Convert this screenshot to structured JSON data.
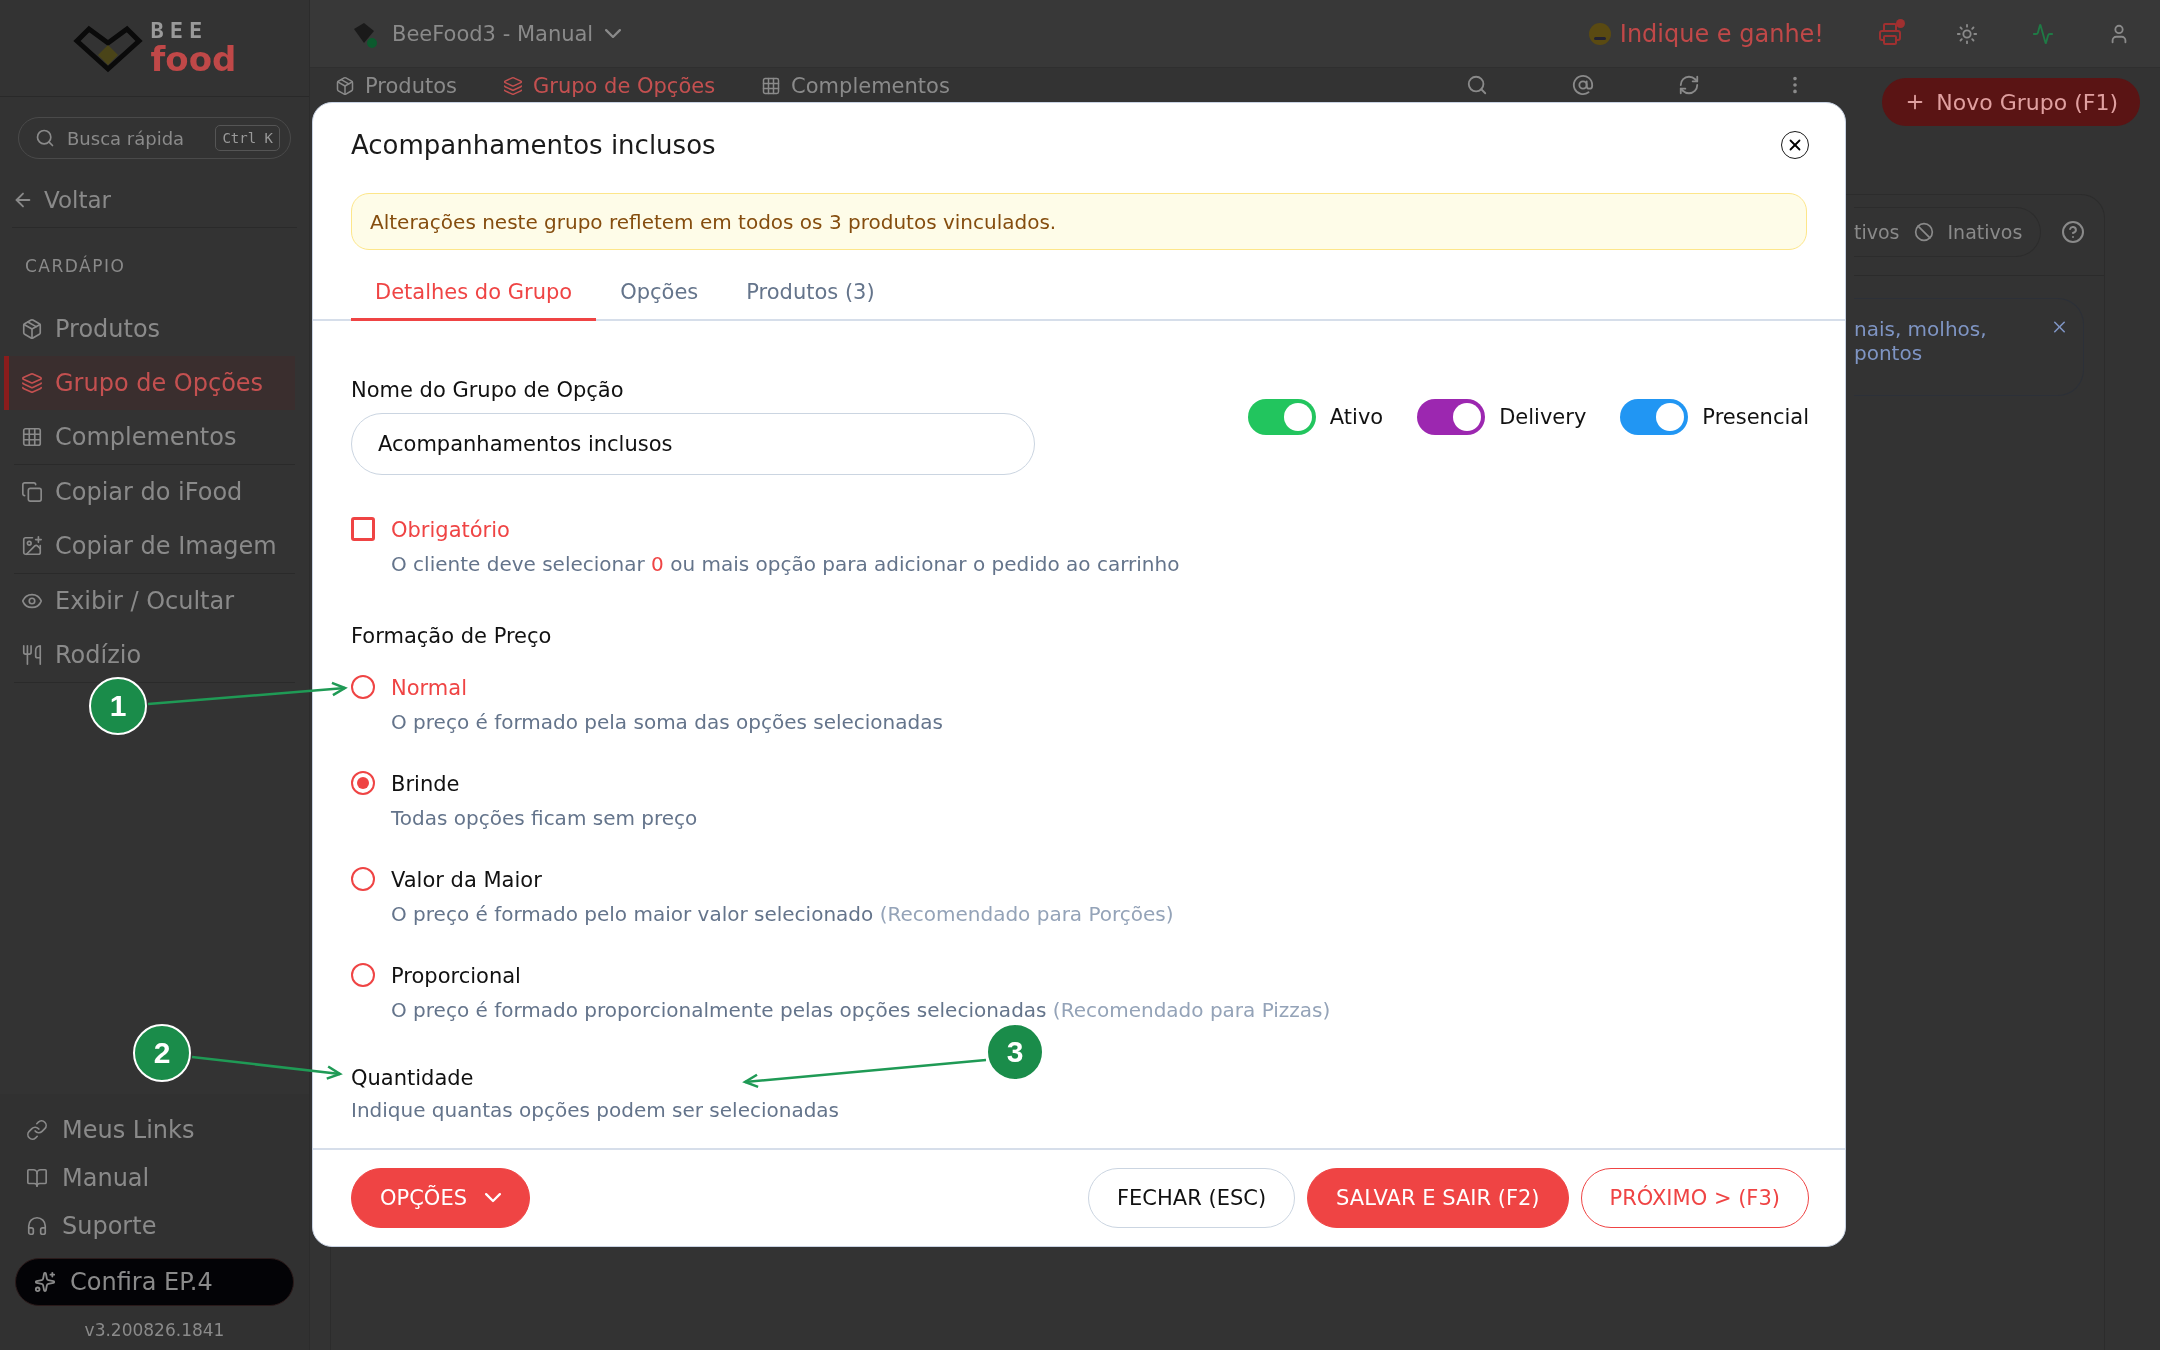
{
  "sidebar": {
    "logo": {
      "top": "BEE",
      "bottom": "food"
    },
    "search": {
      "placeholder": "Busca rápida",
      "shortcut": "Ctrl K"
    },
    "back": "Voltar",
    "section": "CARDÁPIO",
    "groups": [
      [
        {
          "label": "Produtos",
          "selected": false
        },
        {
          "label": "Grupo de Opções",
          "selected": true
        },
        {
          "label": "Complementos",
          "selected": false
        }
      ],
      [
        {
          "label": "Copiar do iFood",
          "selected": false
        },
        {
          "label": "Copiar de Imagem",
          "selected": false
        }
      ],
      [
        {
          "label": "Exibir / Ocultar",
          "selected": false
        },
        {
          "label": "Rodízio",
          "selected": false
        }
      ]
    ],
    "footer_links": [
      "Meus Links",
      "Manual",
      "Suporte"
    ],
    "promo": "Confira EP.4",
    "version": "v3.200826.1841"
  },
  "topbar": {
    "store": "BeeFood3 - Manual",
    "referral": "Indique e ganhe!"
  },
  "subbar": {
    "tabs": [
      {
        "label": "Produtos",
        "selected": false
      },
      {
        "label": "Grupo de Opções",
        "selected": true
      },
      {
        "label": "Complementos",
        "selected": false
      }
    ],
    "new_button": "Novo Grupo (F1)"
  },
  "background_panel": {
    "filter_fragment": "tivos",
    "filter_inactive": "Inativos",
    "notice_fragment": "nais, molhos, pontos"
  },
  "modal": {
    "title": "Acompanhamentos inclusos",
    "alert": "Alterações neste grupo refletem em todos os 3 produtos vinculados.",
    "tabs": [
      {
        "label": "Detalhes do Grupo",
        "selected": true
      },
      {
        "label": "Opções",
        "selected": false
      },
      {
        "label": "Produtos (3)",
        "selected": false
      }
    ],
    "name_label": "Nome do Grupo de Opção",
    "name_value": "Acompanhamentos inclusos",
    "toggles": [
      {
        "label": "Ativo",
        "on": true,
        "color": "#22c55e"
      },
      {
        "label": "Delivery",
        "on": true,
        "color": "#9c27b0"
      },
      {
        "label": "Presencial",
        "on": true,
        "color": "#2196f3"
      }
    ],
    "required": {
      "label": "Obrigatório",
      "checked": false,
      "desc_before": "O cliente deve selecionar",
      "count": "0",
      "desc_after": "ou mais opção para adicionar o pedido ao carrinho"
    },
    "pricing_label": "Formação de Preço",
    "pricing": [
      {
        "label": "Normal",
        "desc": "O preço é formado pela soma das opções selecionadas",
        "selected": false,
        "highlighted": true
      },
      {
        "label": "Brinde",
        "desc": "Todas opções ficam sem preço",
        "selected": true,
        "highlighted": false
      },
      {
        "label": "Valor da Maior",
        "desc": "O preço é formado pelo maior valor selecionado",
        "note": "(Recomendado para Porções)",
        "selected": false,
        "highlighted": false
      },
      {
        "label": "Proporcional",
        "desc": "O preço é formado proporcionalmente pelas opções selecionadas",
        "note": "(Recomendado para Pizzas)",
        "selected": false,
        "highlighted": false
      }
    ],
    "quantity_label": "Quantidade",
    "quantity_desc": "Indique quantas opções podem ser selecionadas",
    "footer": {
      "options": "OPÇÕES",
      "close": "FECHAR (ESC)",
      "save": "SALVAR E SAIR (F2)",
      "next": "PRÓXIMO > (F3)"
    }
  },
  "annotations": [
    {
      "label": "1"
    },
    {
      "label": "2"
    },
    {
      "label": "3"
    }
  ]
}
